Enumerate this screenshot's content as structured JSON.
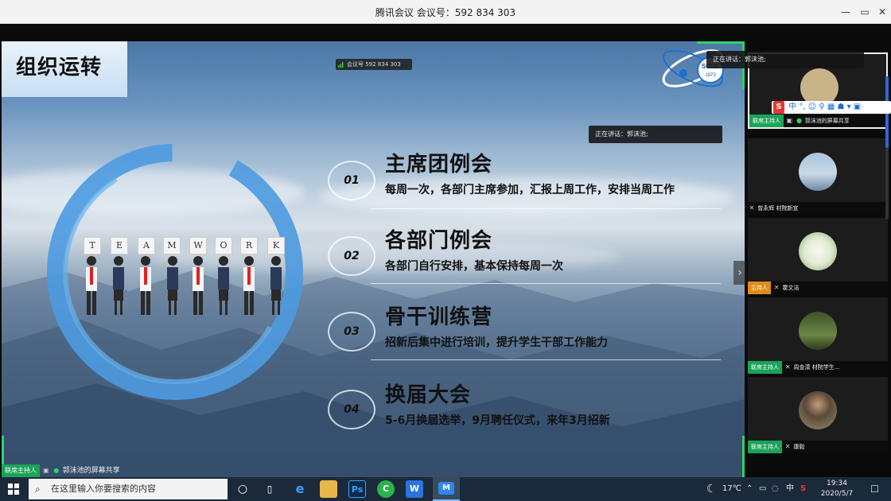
{
  "window": {
    "title": "腾讯会议 会议号：592 834 303",
    "controls": [
      "—",
      "▭",
      "✕"
    ]
  },
  "slide": {
    "title": "组织运转",
    "meeting_id_pill": "会议号 592 834 303",
    "logo_text": "SCCE",
    "logo_year": "1973",
    "teamwork_letters": [
      "T",
      "E",
      "A",
      "M",
      "W",
      "O",
      "R",
      "K"
    ],
    "items": [
      {
        "num": "01",
        "title": "主席团例会",
        "desc": "每周一次，各部门主席参加，汇报上周工作，安排当周工作"
      },
      {
        "num": "02",
        "title": "各部门例会",
        "desc": "各部门自行安排，基本保持每周一次"
      },
      {
        "num": "03",
        "title": "骨干训练营",
        "desc": "招新后集中进行培训，提升学生干部工作能力"
      },
      {
        "num": "04",
        "title": "换届大会",
        "desc": "5-6月换届选举，9月聘任仪式，来年3月招新"
      }
    ]
  },
  "speaking": {
    "label_center": "正在讲话：郭沫池;",
    "label_right": "正在讲话：郭沫池;"
  },
  "participants": [
    {
      "tag": "联席主持人",
      "tag_color": "#1aa35a",
      "name": "郭沫池的屏幕共享",
      "active": true,
      "avatar_color": "#c9b48a"
    },
    {
      "tag": "",
      "tag_color": "",
      "name": "曾永辉 材院新宣",
      "active": false,
      "avatar_color": "#8aa9c0"
    },
    {
      "tag": "主持人",
      "tag_color": "#e08c1a",
      "name": "霍文洁",
      "active": false,
      "avatar_color": "#e7eedc"
    },
    {
      "tag": "联席主持人",
      "tag_color": "#1aa35a",
      "name": "周金濛 材院学生...",
      "active": false,
      "avatar_color": "#4f6a36"
    },
    {
      "tag": "联席主持人",
      "tag_color": "#1aa35a",
      "name": "康毅",
      "active": false,
      "avatar_color": "#7a6a55"
    }
  ],
  "ime": {
    "brand": "S",
    "items": "中 °, ☺ ⚲ ▦ ☗ ▾ ▣"
  },
  "bottom_status": {
    "tag": "联席主持人",
    "text": "郭沫池的屏幕共享"
  },
  "taskbar": {
    "search_placeholder": "在这里输入你要搜索的内容",
    "apps": [
      "e",
      "📁",
      "Ps",
      "C",
      "W",
      "M"
    ],
    "temperature": "17℃",
    "ime": "中",
    "time": "19:34",
    "date": "2020/5/7"
  },
  "colors": {
    "host_green": "#1aa35a",
    "host_orange": "#e08c1a",
    "frame_green": "#2bd46a"
  }
}
